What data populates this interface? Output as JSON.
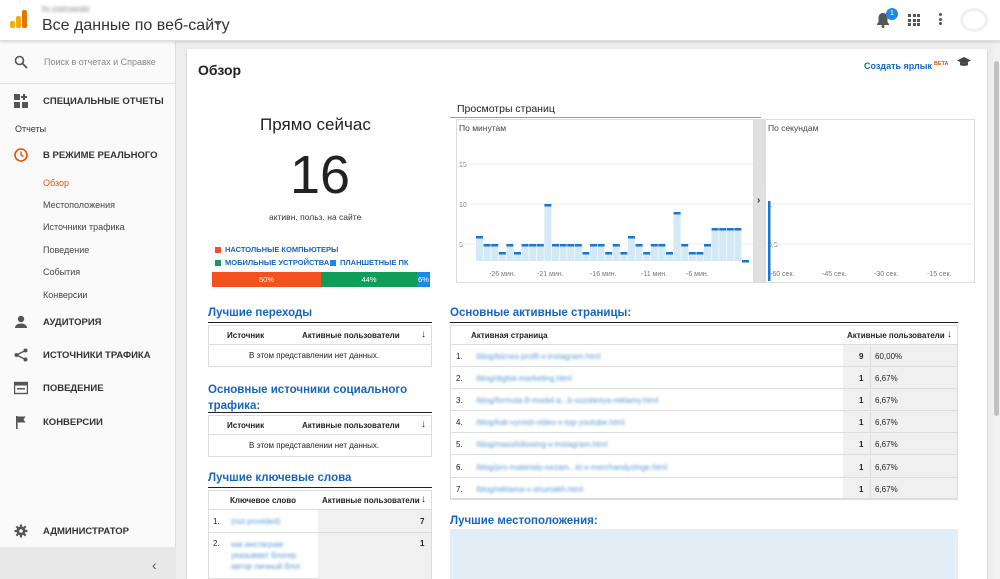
{
  "header": {
    "account": "hr.ostrowski",
    "property": "Все данные по веб-сайту",
    "notifications": "1"
  },
  "sidebar": {
    "search_placeholder": "Поиск в отчетах и Справке",
    "custom_reports": "Специальные отчеты",
    "reports_label": "Отчеты",
    "realtime": "В режиме реального",
    "realtime_items": [
      "Обзор",
      "Местоположения",
      "Источники трафика",
      "Поведение",
      "События",
      "Конверсии"
    ],
    "audience": "Аудитория",
    "acquisition": "Источники трафика",
    "behavior": "Поведение",
    "conversions": "Конверсии",
    "admin": "Администратор"
  },
  "page": {
    "title": "Обзор",
    "shortcut": "Создать ярлык",
    "beta": "BETA"
  },
  "realtime": {
    "title": "Прямо сейчас",
    "count": "16",
    "subtitle": "активн. польз. на сайте",
    "legend": [
      {
        "label": "Настольные компьютеры",
        "color": "#f4511e"
      },
      {
        "label": "Мобильные устройства",
        "color": "#0f9d58"
      },
      {
        "label": "Планшетные ПК",
        "color": "#1e88e5"
      }
    ],
    "split": [
      {
        "label": "50%",
        "value": 50,
        "color": "#f4511e"
      },
      {
        "label": "44%",
        "value": 44,
        "color": "#0f9d58"
      },
      {
        "label": "6%",
        "value": 6,
        "color": "#1e88e5"
      }
    ]
  },
  "pageviews": {
    "title": "Просмотры страниц",
    "per_minute": "По минутам",
    "per_second": "По секундам",
    "y_left": [
      "15",
      "10",
      "5"
    ],
    "x_left": [
      "-26 мин.",
      "-21 мин.",
      "-16 мин.",
      "-11 мин.",
      "-6 мин."
    ],
    "y_right": [
      "1",
      "0,5"
    ],
    "x_right": [
      "-60 сек.",
      "-45 сек.",
      "-30 сек.",
      "-15 сек."
    ],
    "minute_values": [
      3,
      2,
      2,
      1,
      2,
      1,
      2,
      2,
      2,
      7,
      2,
      2,
      2,
      2,
      1,
      2,
      2,
      1,
      2,
      1,
      3,
      2,
      1,
      2,
      2,
      1,
      6,
      2,
      1,
      1,
      2,
      4,
      4,
      4,
      4,
      0
    ],
    "second_peak": 1
  },
  "top_referrals": {
    "title": "Лучшие переходы",
    "col1": "Источник",
    "col2": "Активные пользователи",
    "empty": "В этом представлении нет данных."
  },
  "social": {
    "title": "Основные источники социального трафика:",
    "col1": "Источник",
    "col2": "Активные пользователи",
    "empty": "В этом представлении нет данных."
  },
  "keywords": {
    "title": "Лучшие ключевые слова",
    "col1": "Ключевое слово",
    "col2": "Активные пользователи",
    "rows": [
      {
        "n": "1.",
        "kw": "(not provided)",
        "v": "7"
      },
      {
        "n": "2.",
        "kw": "как инстаграм указывает блогер автор личный блог",
        "v": "1"
      }
    ]
  },
  "active_pages": {
    "title": "Основные активные страницы:",
    "col1": "Активная страница",
    "col2": "Активные пользователи",
    "rows": [
      {
        "n": "1.",
        "page": "/blog/biznes-profil-v-instagram.html",
        "v": "9",
        "p": "60,00%"
      },
      {
        "n": "2.",
        "page": "/blog/digital-marketing.html",
        "v": "1",
        "p": "6,67%"
      },
      {
        "n": "3.",
        "page": "/blog/formula-8-model-a...b-sozdaniya-reklamy.html",
        "v": "1",
        "p": "6,67%"
      },
      {
        "n": "4.",
        "page": "/blog/kak-vyresti-video-v-top-youtube.html",
        "v": "1",
        "p": "6,67%"
      },
      {
        "n": "5.",
        "page": "/blog/massfollowing-v-instagram.html",
        "v": "1",
        "p": "6,67%"
      },
      {
        "n": "6.",
        "page": "/blog/pro-materialy-nezam...kt-v-merchandyzinge.html",
        "v": "1",
        "p": "6,67%"
      },
      {
        "n": "7.",
        "page": "/blog/reklama-v-shumakh.html",
        "v": "1",
        "p": "6,67%"
      }
    ]
  },
  "locations": {
    "title": "Лучшие местоположения:"
  }
}
